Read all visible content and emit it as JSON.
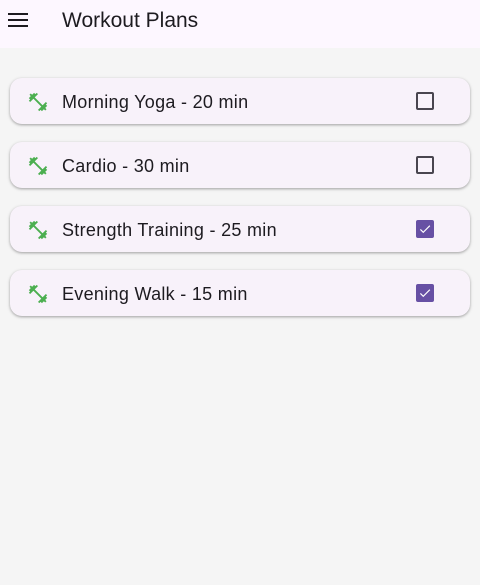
{
  "appbar": {
    "title": "Workout Plans",
    "menu_icon": "menu-icon"
  },
  "colors": {
    "appbar_bg": "#fdf7ff",
    "card_bg": "#f8f2fa",
    "accent": "#6750a4",
    "leading_icon": "#4caf50"
  },
  "workouts": [
    {
      "label": "Morning Yoga - 20 min",
      "icon": "fitness-icon",
      "checked": false
    },
    {
      "label": "Cardio - 30 min",
      "icon": "fitness-icon",
      "checked": false
    },
    {
      "label": "Strength Training - 25 min",
      "icon": "fitness-icon",
      "checked": true
    },
    {
      "label": "Evening Walk - 15 min",
      "icon": "fitness-icon",
      "checked": true
    }
  ]
}
